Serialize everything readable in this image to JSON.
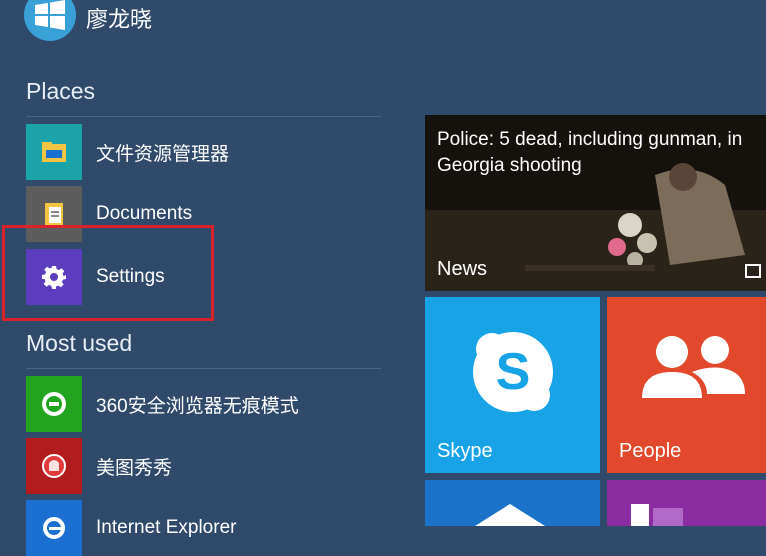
{
  "user": {
    "name": "廖龙晓"
  },
  "places": {
    "title": "Places",
    "items": [
      {
        "label": "文件资源管理器",
        "icon": "folder-icon",
        "color": "#1aa3a8"
      },
      {
        "label": "Documents",
        "icon": "documents-icon",
        "color": "#5d5d5d"
      },
      {
        "label": "Settings",
        "icon": "gear-icon",
        "color": "#5b3dbd"
      }
    ]
  },
  "most_used": {
    "title": "Most used",
    "items": [
      {
        "label": "360安全浏览器无痕模式",
        "icon": "360-browser-icon",
        "color": "#23a41f"
      },
      {
        "label": "美图秀秀",
        "icon": "meitu-icon",
        "color": "#b31c1c"
      },
      {
        "label": "Internet Explorer",
        "icon": "ie-icon",
        "color": "#1a6fd1"
      }
    ]
  },
  "tiles": {
    "news": {
      "headline": "Police: 5 dead, including gunman, in Georgia shooting",
      "label": "News"
    },
    "skype": {
      "label": "Skype",
      "color": "#17a3e6"
    },
    "people": {
      "label": "People",
      "color": "#e2482b"
    }
  },
  "colors": {
    "background": "#2f4a6b",
    "highlight": "#d8222c"
  }
}
